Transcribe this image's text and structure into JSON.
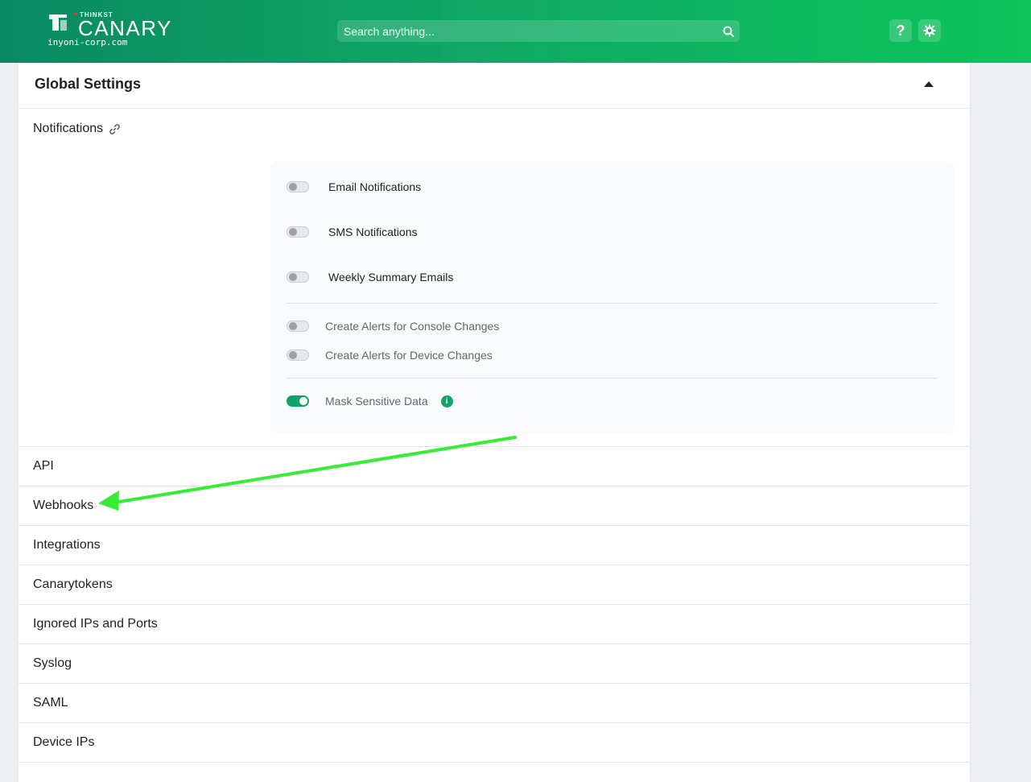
{
  "header": {
    "logo_small": "THINKST",
    "logo_big": "CANARY",
    "domain": "inyoni-corp.com",
    "search_placeholder": "Search anything...",
    "help_label": "?",
    "brand_color": "#10a36b"
  },
  "card": {
    "title": "Global Settings",
    "section_title": "Notifications"
  },
  "notifications": {
    "main": [
      {
        "label": "Email Notifications",
        "on": false
      },
      {
        "label": "SMS Notifications",
        "on": false
      },
      {
        "label": "Weekly Summary Emails",
        "on": false
      }
    ],
    "alerts": [
      {
        "label": "Create Alerts for Console Changes",
        "on": false
      },
      {
        "label": "Create Alerts for Device Changes",
        "on": false
      }
    ],
    "mask": {
      "label": "Mask Sensitive Data",
      "on": true,
      "info": "i"
    }
  },
  "menu": [
    "API",
    "Webhooks",
    "Integrations",
    "Canarytokens",
    "Ignored IPs and Ports",
    "Syslog",
    "SAML",
    "Device IPs"
  ],
  "annotation": {
    "arrow_color": "#33ee33",
    "points_to": "Webhooks"
  }
}
